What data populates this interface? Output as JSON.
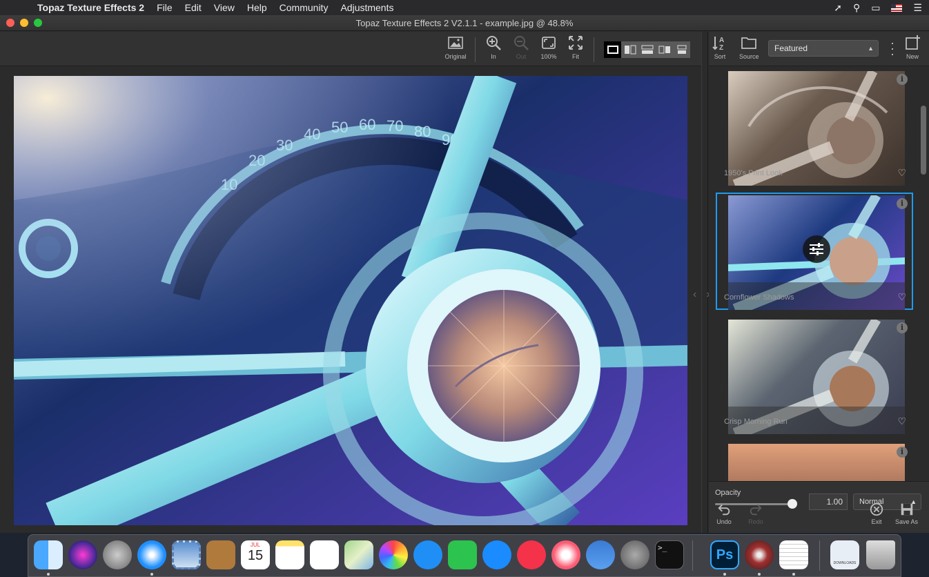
{
  "menubar": {
    "app_name": "Topaz Texture Effects 2",
    "items": [
      "File",
      "Edit",
      "View",
      "Help",
      "Community",
      "Adjustments"
    ]
  },
  "window": {
    "title": "Topaz Texture Effects 2 V2.1.1 - example.jpg @ 48.8%"
  },
  "toolbar": {
    "original": "Original",
    "zoom_in": "In",
    "zoom_out": "Out",
    "zoom_100": "100%",
    "fit": "Fit"
  },
  "panel": {
    "sort": "Sort",
    "source": "Source",
    "filter_selected": "Featured",
    "new": "New",
    "presets": [
      {
        "name": "1950's Print Look",
        "selected": false
      },
      {
        "name": "Cornflower Shadows",
        "selected": true
      },
      {
        "name": "Crisp Morning Run",
        "selected": false
      },
      {
        "name": "",
        "selected": false
      }
    ],
    "opacity_label": "Opacity",
    "opacity_value": "1.00",
    "opacity_level": 1.0,
    "blend_mode": "Normal",
    "undo": "Undo",
    "redo": "Redo",
    "exit": "Exit",
    "save_as": "Save As"
  },
  "colors": {
    "selection_accent": "#1e9bf0",
    "close": "#fe5f57",
    "minimize": "#febc2e",
    "maximize": "#28c840"
  },
  "dock": {
    "apps": [
      "Finder",
      "Siri",
      "Launchpad",
      "Safari",
      "Mail",
      "Contacts",
      "Calendar",
      "Notes",
      "Reminders",
      "Maps",
      "Photos",
      "Messages",
      "FaceTime",
      "App Store",
      "News",
      "Music",
      "Affinity",
      "System Preferences",
      "Terminal",
      "Photoshop",
      "Topaz",
      "TextEdit",
      "Downloads",
      "Trash"
    ],
    "calendar_month": "JUL",
    "calendar_day": "15",
    "photoshop": "Ps",
    "downloads": "DOWNLOADS"
  }
}
